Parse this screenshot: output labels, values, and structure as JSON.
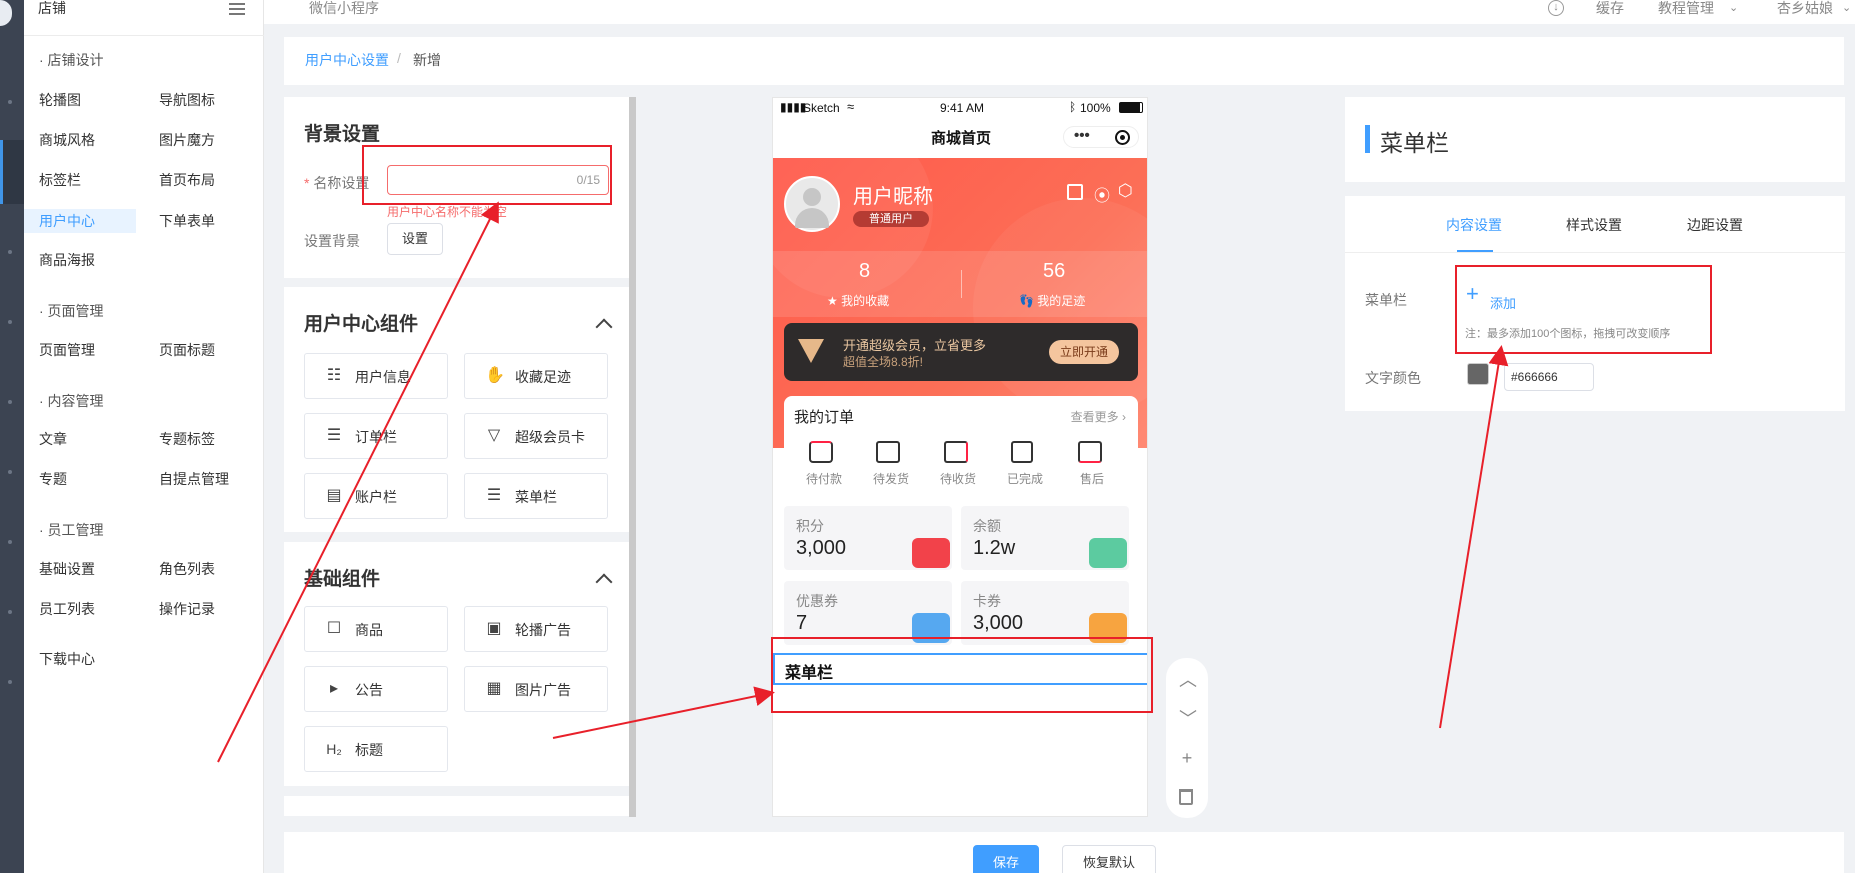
{
  "topbar": {
    "shop_title": "店铺",
    "mini_program": "微信小程序",
    "cache": "缓存",
    "tutorial": "教程管理",
    "user": "杏乡姑娘"
  },
  "menu": {
    "groups": [
      {
        "label": "· 店铺设计",
        "items": [
          [
            "轮播图",
            "导航图标"
          ],
          [
            "商城风格",
            "图片魔方"
          ],
          [
            "标签栏",
            "首页布局"
          ],
          [
            "用户中心",
            "下单表单"
          ],
          [
            "商品海报",
            ""
          ]
        ]
      },
      {
        "label": "· 页面管理",
        "items": [
          [
            "页面管理",
            "页面标题"
          ]
        ]
      },
      {
        "label": "· 内容管理",
        "items": [
          [
            "文章",
            "专题标签"
          ],
          [
            "专题",
            "自提点管理"
          ]
        ]
      },
      {
        "label": "· 员工管理",
        "items": [
          [
            "基础设置",
            "角色列表"
          ],
          [
            "员工列表",
            "操作记录"
          ]
        ]
      }
    ],
    "download": "下载中心",
    "active": "用户中心"
  },
  "breadcrumb": {
    "parent": "用户中心设置",
    "sep": "/",
    "current": "新增"
  },
  "bg_settings": {
    "title": "背景设置",
    "name_label": "名称设置",
    "required_mark": "*",
    "name_value": "",
    "name_count": "0/15",
    "name_error": "用户中心名称不能为空",
    "bg_label": "设置背景",
    "bg_button": "设置"
  },
  "user_components": {
    "title": "用户中心组件",
    "items": [
      {
        "label": "用户信息",
        "icon": "user-card-icon"
      },
      {
        "label": "收藏足迹",
        "icon": "footprint-icon"
      },
      {
        "label": "订单栏",
        "icon": "document-icon"
      },
      {
        "label": "超级会员卡",
        "icon": "vip-icon"
      },
      {
        "label": "账户栏",
        "icon": "wallet-icon"
      },
      {
        "label": "菜单栏",
        "icon": "list-icon"
      }
    ]
  },
  "basic_components": {
    "title": "基础组件",
    "items": [
      {
        "label": "商品",
        "icon": "bag-icon"
      },
      {
        "label": "轮播广告",
        "icon": "carousel-icon"
      },
      {
        "label": "公告",
        "icon": "speaker-icon"
      },
      {
        "label": "图片广告",
        "icon": "image-icon"
      },
      {
        "label": "标题",
        "icon": "h2-icon",
        "icon_text": "H₂"
      }
    ]
  },
  "phone": {
    "status_carrier": "Sketch",
    "status_time": "9:41 AM",
    "status_battery": "100%",
    "page_title": "商城首页",
    "nickname": "用户昵称",
    "user_level": "普通用户",
    "fav_count": "8",
    "fav_label": "我的收藏",
    "track_count": "56",
    "track_label": "我的足迹",
    "vip_title": "开通超级会员，立省更多",
    "vip_sub": "超值全场8.8折!",
    "vip_button": "立即开通",
    "orders_title": "我的订单",
    "orders_more": "查看更多 ›",
    "order_items": [
      "待付款",
      "待发货",
      "待收货",
      "已完成",
      "售后"
    ],
    "accounts": [
      {
        "label": "积分",
        "value": "3,000",
        "color": "#f2424a"
      },
      {
        "label": "余额",
        "value": "1.2w",
        "color": "#5ccba0"
      },
      {
        "label": "优惠券",
        "value": "7",
        "color": "#56a8f0"
      },
      {
        "label": "卡券",
        "value": "3,000",
        "color": "#f7a440"
      }
    ],
    "menu_bar": "菜单栏"
  },
  "right_panel": {
    "title": "菜单栏",
    "tabs": [
      "内容设置",
      "样式设置",
      "边距设置"
    ],
    "active_tab": "内容设置",
    "menu_label": "菜单栏",
    "add_label": "添加",
    "note": "注：最多添加100个图标，拖拽可改变顺序",
    "text_color_label": "文字颜色",
    "text_color_value": "#666666"
  },
  "footer": {
    "save": "保存",
    "reset": "恢复默认"
  },
  "colors": {
    "accent": "#409eff",
    "annotation": "#e8202a",
    "brand_red": "#ff5a4b"
  }
}
